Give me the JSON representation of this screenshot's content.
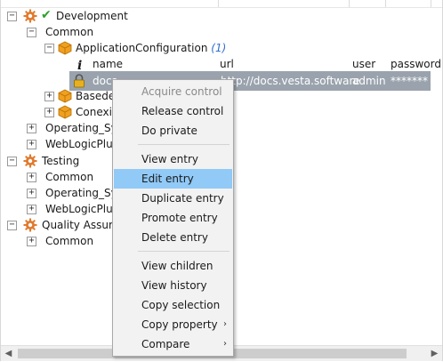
{
  "tree": {
    "development": {
      "label": "Development"
    },
    "dev_common": {
      "label": "Common"
    },
    "app_config": {
      "label": "ApplicationConfiguration",
      "count": "(1)"
    },
    "columns": {
      "name": "name",
      "url": "url",
      "user": "user",
      "password": "password"
    },
    "entry": {
      "name": "docs",
      "url": "http://docs.vesta.software",
      "user": "admin",
      "password": "*******"
    },
    "basedel": {
      "label": "Basedel"
    },
    "conexio": {
      "label": "Conexio"
    },
    "dev_operating": {
      "label": "Operating_Sys"
    },
    "dev_weblogic": {
      "label": "WebLogicPlug"
    },
    "testing": {
      "label": "Testing"
    },
    "test_common": {
      "label": "Common"
    },
    "test_operating": {
      "label": "Operating_Sys"
    },
    "test_weblogic": {
      "label": "WebLogicPlug"
    },
    "qa": {
      "label": "Quality Assura"
    },
    "qa_common": {
      "label": "Common"
    }
  },
  "toggles": {
    "expanded": "−",
    "collapsed": "+"
  },
  "context_menu": {
    "acquire_control": "Acquire control",
    "release_control": "Release control",
    "do_private": "Do private",
    "view_entry": "View entry",
    "edit_entry": "Edit entry",
    "duplicate_entry": "Duplicate entry",
    "promote_entry": "Promote entry",
    "delete_entry": "Delete entry",
    "view_children": "View children",
    "view_history": "View history",
    "copy_selection": "Copy selection",
    "copy_property": "Copy property",
    "compare": "Compare",
    "submenu_arrow": "›"
  },
  "scrollbar": {
    "left_arrow": "◀",
    "right_arrow": "▶"
  },
  "colors": {
    "selection": "#9aa3ad",
    "menu_highlight": "#91c9f7",
    "count": "#2f6fcc",
    "check": "#2aa02a",
    "gear": "#e07a2e",
    "box": "#f0a020"
  }
}
